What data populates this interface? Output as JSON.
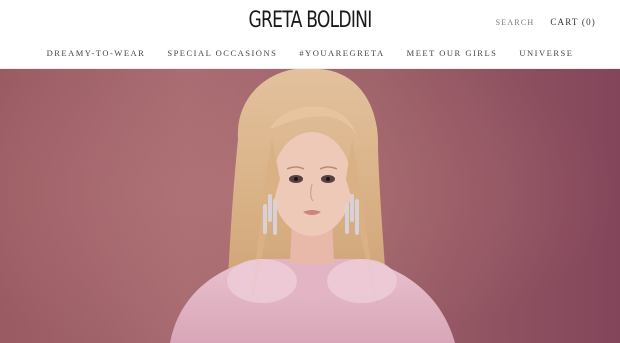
{
  "header": {
    "logo_text": "GRETA BOLDINI",
    "search_label": "SEARCH",
    "cart_label": "CART (0)"
  },
  "nav": {
    "items": [
      {
        "label": "DREAMY-TO-WEAR"
      },
      {
        "label": "SPECIAL OCCASIONS"
      },
      {
        "label": "#YOUAREGRETA"
      },
      {
        "label": "MEET OUR GIRLS"
      },
      {
        "label": "UNIVERSE"
      }
    ]
  },
  "hero": {
    "image_name": "hero-model-photo"
  },
  "colors": {
    "background": "#ffffff",
    "text": "#1a1a1a",
    "hero_left": "#9a5a62",
    "hero_right": "#83455a"
  }
}
